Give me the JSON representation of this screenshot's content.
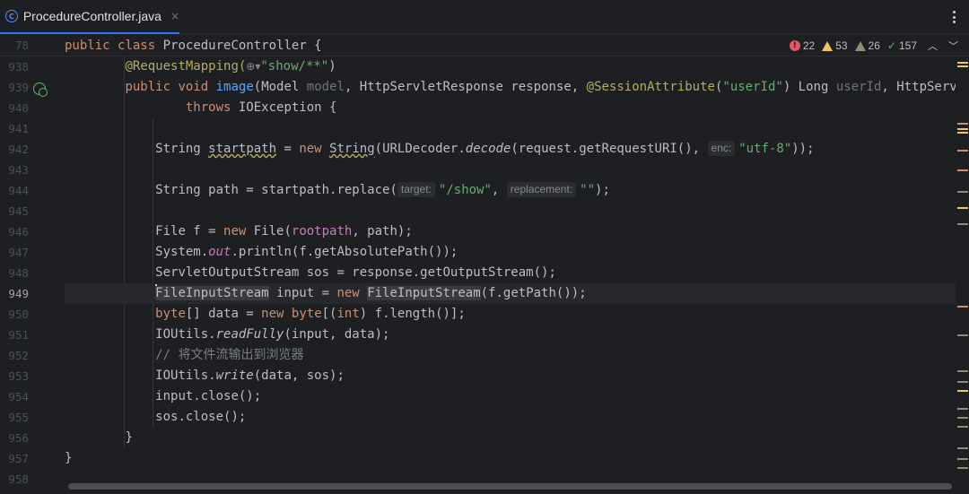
{
  "tab": {
    "label": "ProcedureController.java",
    "icon": "class-icon",
    "close": "×"
  },
  "sticky": {
    "line": "78",
    "text_kw1": "public",
    "text_kw2": "class",
    "text_rest": " ProcedureController {"
  },
  "inspections": {
    "errors": "22",
    "warnings": "53",
    "weak": "26",
    "ok": "157"
  },
  "lines": [
    "938",
    "939",
    "940",
    "941",
    "942",
    "943",
    "944",
    "945",
    "946",
    "947",
    "948",
    "949",
    "950",
    "951",
    "952",
    "953",
    "954",
    "955",
    "956",
    "957",
    "958"
  ],
  "code": {
    "l938_annot": "@RequestMapping(",
    "l938_str": "\"show/**\"",
    "l938_close": ")",
    "l939_public": "public",
    "l939_void": "void",
    "l939_name": "image",
    "l939_a": "(Model ",
    "l939_model": "model",
    "l939_b": ", HttpServletResponse response, ",
    "l939_annot": "@SessionAttribute",
    "l939_c": "(",
    "l939_str": "\"userId\"",
    "l939_d": ") Long ",
    "l939_userid": "userId",
    "l939_e": ", HttpServletRequest request)",
    "l940_throws": "throws",
    "l940_rest": " IOException {",
    "l942_a": "String ",
    "l942_var": "startpath",
    "l942_b": " = ",
    "l942_new": "new",
    "l942_sp": " ",
    "l942_cls": "String",
    "l942_c": "(URLDecoder.",
    "l942_decode": "decode",
    "l942_d": "(request.getRequestURI(), ",
    "l942_hint": "enc:",
    "l942_str": "\"utf-8\"",
    "l942_e": "));",
    "l944_a": "String path = startpath.replace(",
    "l944_hint1": "target:",
    "l944_str1": "\"/show\"",
    "l944_b": ", ",
    "l944_hint2": "replacement:",
    "l944_str2": "\"\"",
    "l944_c": ");",
    "l946_a": "File f = ",
    "l946_new": "new",
    "l946_b": " File(",
    "l946_field": "rootpath",
    "l946_c": ", path);",
    "l947_a": "System.",
    "l947_out": "out",
    "l947_b": ".println(f.getAbsolutePath());",
    "l948_a": "ServletOutputStream sos = response.getOutputStream();",
    "l949_cls": "FileInputStream",
    "l949_a": " input = ",
    "l949_new": "new",
    "l949_sp": " ",
    "l949_cls2": "FileInputStream",
    "l949_b": "(f.getPath());",
    "l950_byte": "byte",
    "l950_a": "[] data = ",
    "l950_new": "new",
    "l950_sp": " ",
    "l950_byte2": "byte",
    "l950_b": "[(",
    "l950_int": "int",
    "l950_c": ") f.length()];",
    "l951_a": "IOUtils.",
    "l951_m": "readFully",
    "l951_b": "(input, data);",
    "l952_comment": "// 将文件流输出到浏览器",
    "l953_a": "IOUtils.",
    "l953_m": "write",
    "l953_b": "(data, sos);",
    "l954": "input.close();",
    "l955": "sos.close();",
    "l956": "}",
    "l957": "}"
  },
  "colors": {
    "background": "#1e1f22",
    "keyword": "#cf8e6d",
    "string": "#6aab73",
    "annotation": "#b3ae60",
    "method_decl": "#56a8f5",
    "field": "#c77dbb",
    "error": "#e55765",
    "warning": "#f2c55c"
  }
}
